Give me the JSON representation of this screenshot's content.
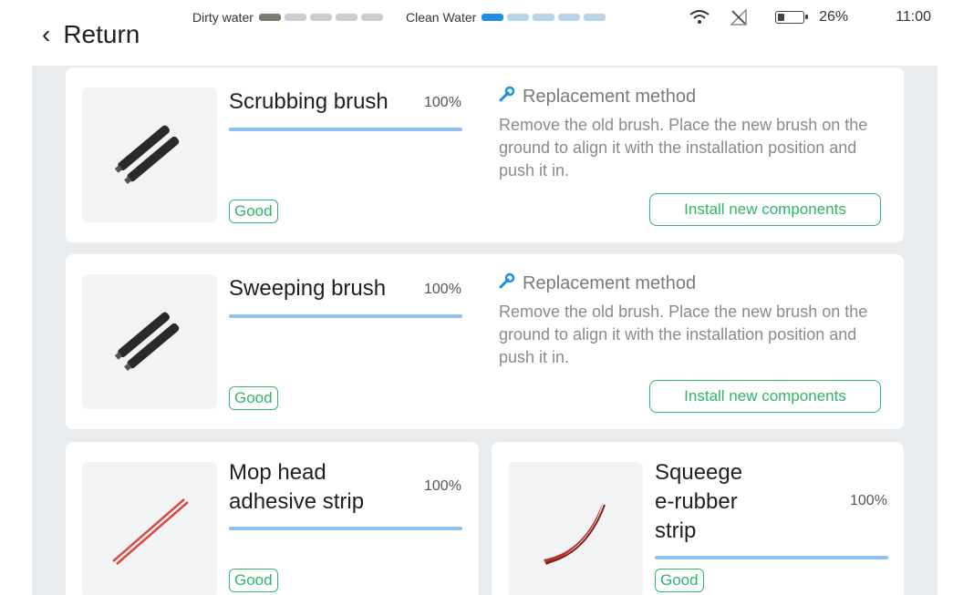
{
  "header": {
    "back_label": "Return",
    "dirty_tank": {
      "label": "Dirty water",
      "segments": 5,
      "filled": 1
    },
    "clean_tank": {
      "label": "Clean Water",
      "segments": 5,
      "filled": 1
    },
    "status": {
      "battery": "26%",
      "time": "11:00"
    }
  },
  "cards": [
    {
      "name": "Scrubbing brush",
      "percent": "100%",
      "condition": "Good",
      "method_title": "Replacement method",
      "method_text": "Remove the old brush. Place the new brush on the ground to align it with the installation position and push it in.",
      "action_label": "Install new components",
      "icon": "brush-rollers-icon"
    },
    {
      "name": "Sweeping brush",
      "percent": "100%",
      "condition": "Good",
      "method_title": "Replacement method",
      "method_text": "Remove the old brush. Place the new brush on the ground to align it with the installation position and push it in.",
      "action_label": "Install new components",
      "icon": "brush-rollers-icon"
    },
    {
      "name_line1": "Mop head",
      "name_line2": "adhesive strip",
      "percent": "100%",
      "condition": "Good",
      "icon": "adhesive-strip-icon"
    },
    {
      "name_line1": "Squeege",
      "name_line2": "e-rubber",
      "name_line3": "strip",
      "percent": "100%",
      "condition": "Good",
      "icon": "rubber-strip-icon"
    }
  ],
  "colors": {
    "accent_green": "#2fb566",
    "progress_blue": "#8fc0ef",
    "clean_water_blue": "#1e8fe0",
    "page_bg": "#e9ecef"
  }
}
